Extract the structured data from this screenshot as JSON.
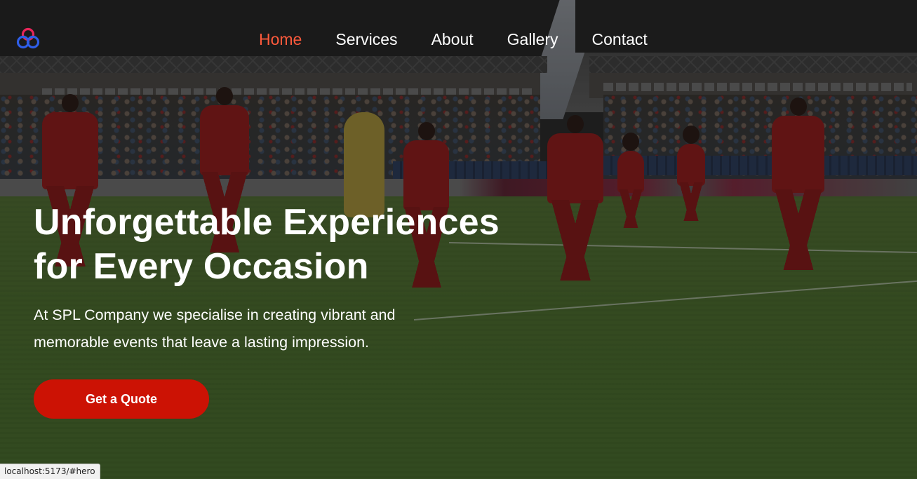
{
  "nav": {
    "logo_icon": "spl-interlocking-rings-logo",
    "items": [
      {
        "label": "Home",
        "active": true
      },
      {
        "label": "Services",
        "active": false
      },
      {
        "label": "About",
        "active": false
      },
      {
        "label": "Gallery",
        "active": false
      },
      {
        "label": "Contact",
        "active": false
      }
    ],
    "active_color": "#ff5a3c"
  },
  "hero": {
    "title_line1": "Unforgettable Experiences",
    "title_line2": "for Every Occasion",
    "subtitle": "At SPL Company we specialise in creating vibrant and memorable events that leave a lasting impression.",
    "cta_label": "Get a Quote",
    "cta_color": "#cc1204",
    "background_image": "stadium-dancers-red-outfits"
  },
  "status_bar": {
    "url": "localhost:5173/#hero"
  }
}
